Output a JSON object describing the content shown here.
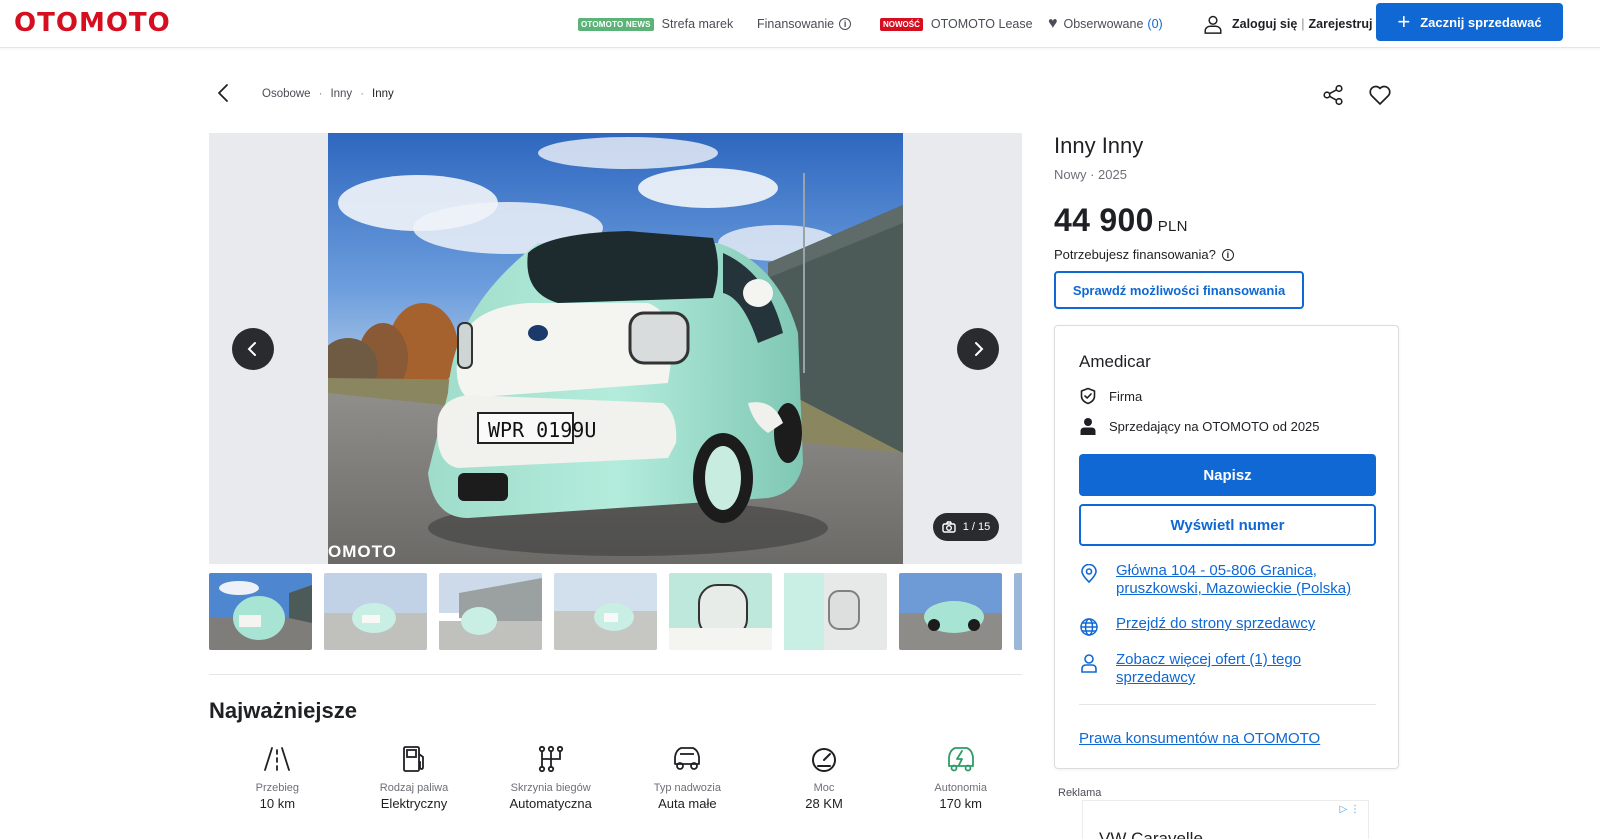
{
  "header": {
    "logo": "OTOMOTO",
    "news_badge": "OTOMOTO NEWS",
    "strefa_marek": "Strefa marek",
    "finansowanie": "Finansowanie",
    "new_badge": "NOWOŚĆ",
    "lease": "OTOMOTO Lease",
    "observed": "Obserwowane",
    "observed_count": "(0)",
    "login": "Zaloguj się",
    "login_sep": "|",
    "register": "Zarejestruj się",
    "sell_button": "Zacznij sprzedawać"
  },
  "breadcrumb": [
    "Osobowe",
    "Inny",
    "Inny"
  ],
  "gallery": {
    "counter": "1 / 15",
    "watermark": "OMOTO",
    "thumb_count": 7
  },
  "highlights": {
    "title": "Najważniejsze",
    "items": [
      {
        "label": "Przebieg",
        "value": "10 km",
        "icon": "road-icon"
      },
      {
        "label": "Rodzaj paliwa",
        "value": "Elektryczny",
        "icon": "fuel-pump-icon"
      },
      {
        "label": "Skrzynia biegów",
        "value": "Automatyczna",
        "icon": "gearbox-icon"
      },
      {
        "label": "Typ nadwozia",
        "value": "Auta małe",
        "icon": "car-body-icon"
      },
      {
        "label": "Moc",
        "value": "28 KM",
        "icon": "speedometer-icon"
      },
      {
        "label": "Autonomia",
        "value": "170 km",
        "icon": "ev-battery-icon"
      }
    ]
  },
  "listing": {
    "title": "Inny Inny",
    "subtitle": "Nowy · 2025",
    "price": "44 900",
    "currency": "PLN",
    "financing_question": "Potrzebujesz finansowania?",
    "financing_button": "Sprawdź możliwości finansowania"
  },
  "seller": {
    "name": "Amedicar",
    "type": "Firma",
    "since": "Sprzedający na OTOMOTO od 2025",
    "write_button": "Napisz",
    "phone_button": "Wyświetl numer",
    "address": "Główna 104 - 05-806 Granica, pruszkowski, Mazowieckie (Polska)",
    "website": "Przejdź do strony sprzedawcy",
    "more_offers": "Zobacz więcej ofert (1) tego sprzedawcy",
    "consumer_rights": "Prawa konsumentów na OTOMOTO"
  },
  "ad": {
    "label": "Reklama",
    "title": "VW Caravelle",
    "icons": "▷ ⋮"
  },
  "colors": {
    "brand_red": "#d50f20",
    "primary_blue": "#0f68d4",
    "news_green": "#5cb377",
    "car_mint": "#a8e4d4"
  }
}
